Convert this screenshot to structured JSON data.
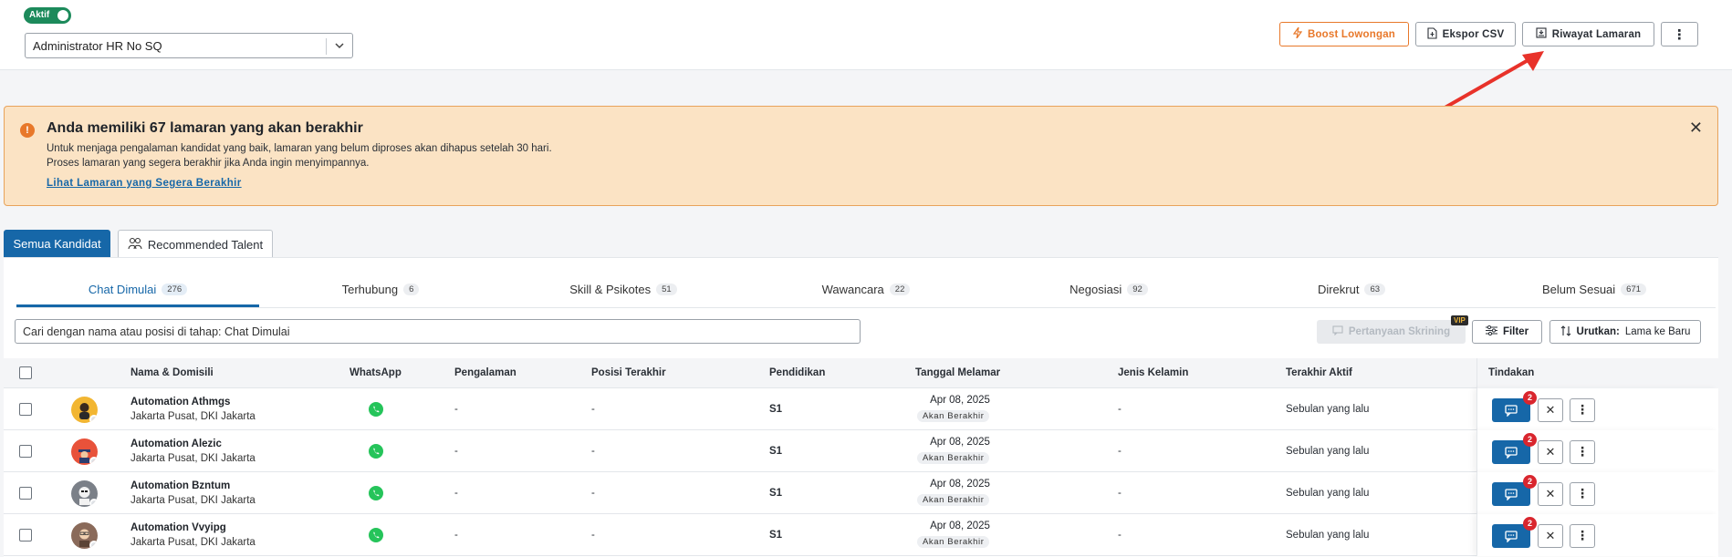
{
  "header": {
    "toggle_label": "Aktif",
    "job_select_value": "Administrator HR No SQ",
    "boost_label": "Boost Lowongan",
    "export_label": "Ekspor CSV",
    "history_label": "Riwayat Lamaran"
  },
  "alert": {
    "title": "Anda memiliki 67 lamaran yang akan berakhir",
    "line1": "Untuk menjaga pengalaman kandidat yang baik, lamaran yang belum diproses akan dihapus setelah 30 hari.",
    "line2": "Proses lamaran yang segera berakhir jika Anda ingin menyimpannya.",
    "link": "Lihat Lamaran yang Segera Berakhir"
  },
  "tabs": {
    "all": "Semua Kandidat",
    "recommended": "Recommended Talent"
  },
  "stages": [
    {
      "label": "Chat Dimulai",
      "count": "276"
    },
    {
      "label": "Terhubung",
      "count": "6"
    },
    {
      "label": "Skill & Psikotes",
      "count": "51"
    },
    {
      "label": "Wawancara",
      "count": "22"
    },
    {
      "label": "Negosiasi",
      "count": "92"
    },
    {
      "label": "Direkrut",
      "count": "63"
    },
    {
      "label": "Belum Sesuai",
      "count": "671"
    }
  ],
  "toolbar": {
    "search_value": "Cari dengan nama atau posisi di tahap: Chat Dimulai",
    "screening_label": "Pertanyaan Skrining",
    "vip_label": "VIP",
    "filter_label": "Filter",
    "sort_label": "Urutkan:",
    "sort_value": "Lama ke Baru"
  },
  "table": {
    "headers": {
      "name": "Nama & Domisili",
      "whatsapp": "WhatsApp",
      "experience": "Pengalaman",
      "last_position": "Posisi Terakhir",
      "education": "Pendidikan",
      "applied_date": "Tanggal Melamar",
      "gender": "Jenis Kelamin",
      "last_active": "Terakhir Aktif",
      "actions": "Tindakan"
    },
    "rows": [
      {
        "name": "Automation Athmgs",
        "location": "Jakarta Pusat, DKI Jakarta",
        "experience": "-",
        "last_position": "-",
        "education": "S1",
        "date": "Apr 08, 2025",
        "status": "Akan Berakhir",
        "gender": "-",
        "last_active": "Sebulan yang lalu",
        "notif": "2",
        "avatar_color": "#f2b632"
      },
      {
        "name": "Automation Alezic",
        "location": "Jakarta Pusat, DKI Jakarta",
        "experience": "-",
        "last_position": "-",
        "education": "S1",
        "date": "Apr 08, 2025",
        "status": "Akan Berakhir",
        "gender": "-",
        "last_active": "Sebulan yang lalu",
        "notif": "2",
        "avatar_color": "#e8523a"
      },
      {
        "name": "Automation Bzntum",
        "location": "Jakarta Pusat, DKI Jakarta",
        "experience": "-",
        "last_position": "-",
        "education": "S1",
        "date": "Apr 08, 2025",
        "status": "Akan Berakhir",
        "gender": "-",
        "last_active": "Sebulan yang lalu",
        "notif": "2",
        "avatar_color": "#7b8088"
      },
      {
        "name": "Automation Vvyipg",
        "location": "Jakarta Pusat, DKI Jakarta",
        "experience": "-",
        "last_position": "-",
        "education": "S1",
        "date": "Apr 08, 2025",
        "status": "Akan Berakhir",
        "gender": "-",
        "last_active": "Sebulan yang lalu",
        "notif": "2",
        "avatar_color": "#8a6a5a"
      }
    ]
  },
  "colors": {
    "primary": "#1667a8",
    "accent_orange": "#e8782a",
    "alert_bg": "#fbe3c4",
    "whatsapp": "#25c45a",
    "notif_red": "#d9262e",
    "annotation_arrow": "#e8322a"
  }
}
